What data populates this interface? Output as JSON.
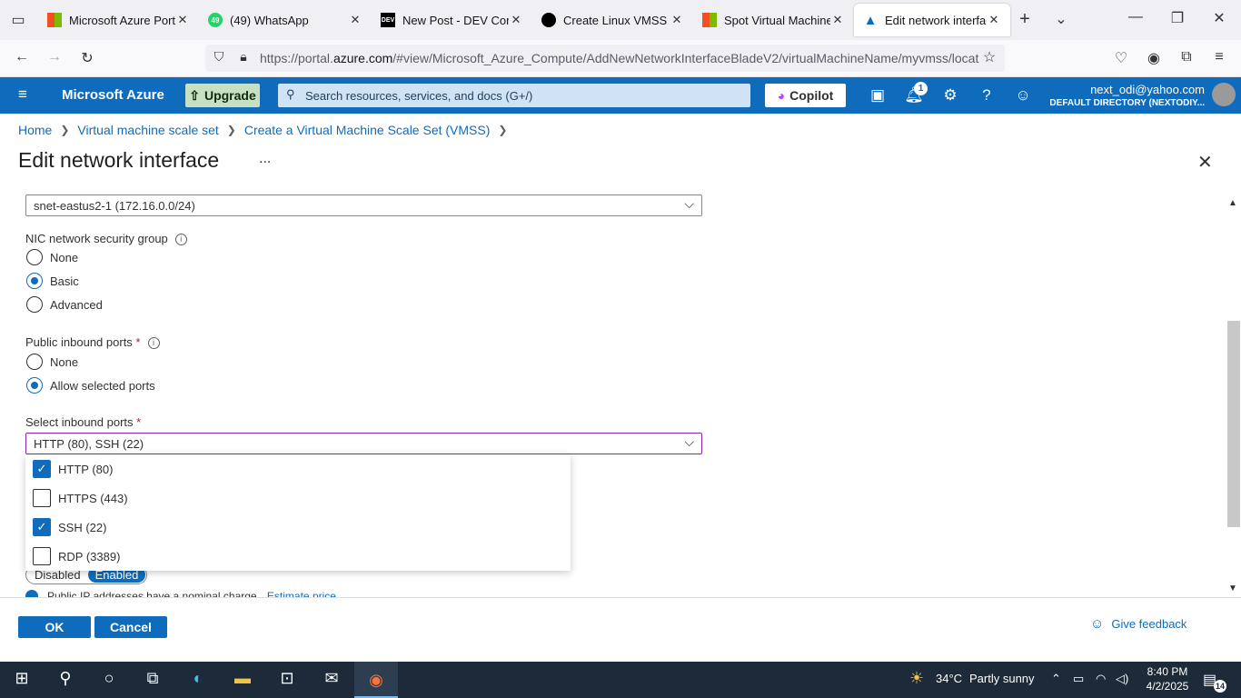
{
  "browser": {
    "tabs": [
      {
        "title": "Microsoft Azure Portal",
        "icon": "microsoft-logo-icon",
        "active": false
      },
      {
        "title": "(49) WhatsApp",
        "icon": "whatsapp-icon",
        "badge": "49",
        "active": false
      },
      {
        "title": "New Post - DEV Comm",
        "icon": "dev-logo-icon",
        "favtext": "DEV",
        "active": false
      },
      {
        "title": "Create Linux VMSS",
        "icon": "chatgpt-icon",
        "active": false
      },
      {
        "title": "Spot Virtual Machines",
        "icon": "microsoft-logo-icon",
        "active": false
      },
      {
        "title": "Edit network interface",
        "icon": "azure-logo-icon",
        "active": true
      }
    ],
    "url_prefix": "https://portal.",
    "url_domain": "azure.com",
    "url_rest": "/#view/Microsoft_Azure_Compute/AddNewNetworkInterfaceBladeV2/virtualMachineName/myvmss/locat"
  },
  "azure_header": {
    "brand": "Microsoft Azure",
    "upgrade_label": "Upgrade",
    "search_placeholder": "Search resources, services, and docs (G+/)",
    "copilot_label": "Copilot",
    "notification_count": "1",
    "user_email": "next_odi@yahoo.com",
    "user_directory": "DEFAULT DIRECTORY (NEXTODIY..."
  },
  "breadcrumb": [
    "Home",
    "Virtual machine scale set",
    "Create a Virtual Machine Scale Set (VMSS)"
  ],
  "page_title": "Edit network interface",
  "more_label": "...",
  "form": {
    "subnet_value": "snet-eastus2-1 (172.16.0.0/24)",
    "nsg_label": "NIC network security group",
    "nsg_options": [
      {
        "label": "None",
        "selected": false
      },
      {
        "label": "Basic",
        "selected": true
      },
      {
        "label": "Advanced",
        "selected": false
      }
    ],
    "public_ports_label": "Public inbound ports",
    "public_ports_options": [
      {
        "label": "None",
        "selected": false
      },
      {
        "label": "Allow selected ports",
        "selected": true
      }
    ],
    "select_ports_label": "Select inbound ports",
    "select_ports_value": "HTTP (80), SSH (22)",
    "port_options": [
      {
        "label": "HTTP (80)",
        "checked": true
      },
      {
        "label": "HTTPS (443)",
        "checked": false
      },
      {
        "label": "SSH (22)",
        "checked": true
      },
      {
        "label": "RDP (3389)",
        "checked": false
      }
    ],
    "toggle_options": [
      "Disabled",
      "Enabled"
    ],
    "toggle_selected": "Enabled",
    "note_text": "Public IP addresses have a nominal charge.",
    "note_link": "Estimate price"
  },
  "footer": {
    "ok_label": "OK",
    "cancel_label": "Cancel",
    "feedback_label": "Give feedback"
  },
  "taskbar": {
    "weather_temp": "34°C",
    "weather_desc": "Partly sunny",
    "time": "8:40 PM",
    "date": "4/2/2025",
    "notification_count": "14"
  },
  "colors": {
    "azure_blue": "#0f6cbd",
    "upgrade_green": "#c7e0c2",
    "required_red": "#a4262c"
  }
}
